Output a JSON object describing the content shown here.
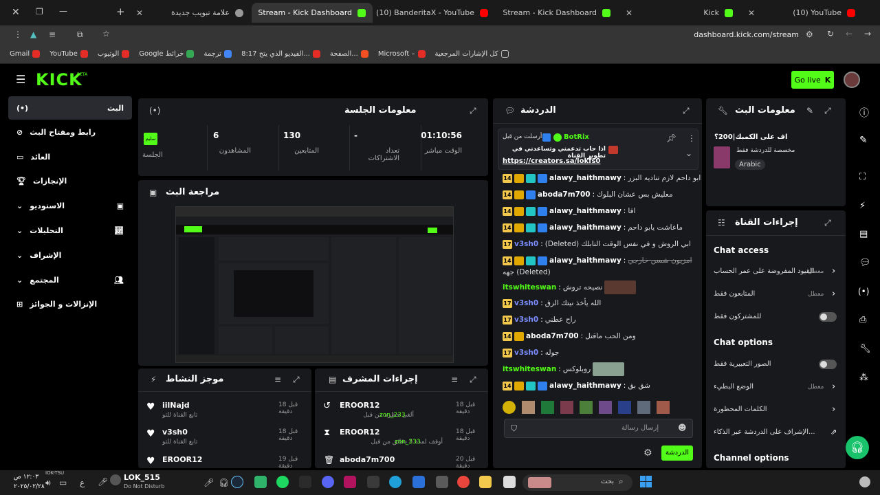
{
  "browser": {
    "tabs": [
      {
        "label": "علامة تبويب جديدة",
        "favicon": "new-tab-icon",
        "active": false
      },
      {
        "label": "Stream - Kick Dashboard",
        "favicon": "kick-icon",
        "active": true
      },
      {
        "label": "(10) BanderitaX - YouTube",
        "favicon": "youtube-icon",
        "active": false
      },
      {
        "label": "Stream - Kick Dashboard",
        "favicon": "kick-icon",
        "active": false
      },
      {
        "label": "Kick",
        "favicon": "kick-icon",
        "active": false
      },
      {
        "label": "(10) YouTube",
        "favicon": "youtube-icon",
        "active": false
      }
    ],
    "url": "dashboard.kick.com/stream",
    "bookmarks": [
      {
        "label": "Gmail"
      },
      {
        "label": "YouTube"
      },
      {
        "label": "الوتيوب"
      },
      {
        "label": "Google خرائط"
      },
      {
        "label": "ترجمة"
      },
      {
        "label": "8:17 الفيديو الذي يتح..."
      },
      {
        "label": "الصفحة..."
      },
      {
        "label": "Microsoft –"
      },
      {
        "label": "كل الإشارات المرجعية"
      }
    ]
  },
  "kick": {
    "logo": "KICK",
    "beta": "BETA",
    "go_live": "Go live"
  },
  "sidebar": {
    "items": [
      {
        "label": "البث",
        "icon": "live-icon"
      },
      {
        "label": "رابط ومفتاح البث",
        "icon": "link-icon"
      },
      {
        "label": "العائد",
        "icon": "revenue-icon"
      },
      {
        "label": "الإنجازات",
        "icon": "trophy-icon"
      },
      {
        "label": "الاستوديو",
        "icon": "studio-icon"
      },
      {
        "label": "التحليلات",
        "icon": "analytics-icon"
      },
      {
        "label": "الإشراف",
        "icon": "moderation-icon"
      },
      {
        "label": "المجتمع",
        "icon": "community-icon"
      },
      {
        "label": "الإنزالات و الجوائز",
        "icon": "drops-icon"
      }
    ]
  },
  "session": {
    "title": "معلومات الجلسة",
    "stats": [
      {
        "value": "01:10:56",
        "label": "الوقت مباشر"
      },
      {
        "value": "-",
        "label": "تعداد الاشتراكات"
      },
      {
        "value": "130",
        "label": "المتابعين"
      },
      {
        "value": "6",
        "label": "المشاهدون"
      },
      {
        "value": "سليم",
        "label": "الجلسة"
      }
    ]
  },
  "preview": {
    "title": "مراجعة البث"
  },
  "activity": {
    "title": "موجز النشاط",
    "items": [
      {
        "user": "iilNajd",
        "desc": "تابع القناة للتو",
        "time": "قبل 18 دقيقة"
      },
      {
        "user": "v3sh0",
        "desc": "تابع القناة للتو",
        "time": "قبل 18 دقيقة"
      },
      {
        "user": "EROOR12",
        "desc": "",
        "time": "قبل 19 دقيقة"
      }
    ]
  },
  "mod_actions": {
    "title": "إجراءات المشرف",
    "items": [
      {
        "user": "EROOR12",
        "desc": "ألغى حظره من قبل",
        "mod": "zon_233",
        "time": "قبل 18 دقيقة"
      },
      {
        "user": "EROOR12",
        "desc": "أوقف لمدة 5 دقائق من قبل",
        "mod": "zon_233",
        "time": "قبل 18 دقيقة"
      },
      {
        "user": "aboda7m700",
        "desc": "",
        "mod": "",
        "time": "قبل 20 دقيقة"
      }
    ]
  },
  "chat": {
    "title": "الدردشة",
    "pinned": {
      "by": "أرسلت من قبل",
      "user": "BotRix",
      "text": "اذا حاب تدعمني وتساعدني في تطوير القناة",
      "link": "https://creators.sa/lokfs0"
    },
    "messages": [
      {
        "user": "alawy_haithmawy",
        "badge": "14",
        "text": "ابو داحم لازم تناديه البزر",
        "color": "#ffffff"
      },
      {
        "user": "aboda7m700",
        "badge": "14",
        "text": "معليش بس عشان البلوك",
        "color": "#ffffff"
      },
      {
        "user": "alawy_haithmawy",
        "badge": "14",
        "text": "افا",
        "color": "#ffffff"
      },
      {
        "user": "alawy_haithmawy",
        "badge": "14",
        "text": "ماعاشت يابو داحم",
        "color": "#ffffff"
      },
      {
        "user": "v3sh0",
        "badge": "17",
        "text": "ابي الروش و في نفس الوقت التابلك (Deleted)",
        "color": "#7b8cff"
      },
      {
        "user": "alawy_haithmawy",
        "badge": "14",
        "text": "امزيون شسن خارجي",
        "color": "#ffffff"
      },
      {
        "user": "",
        "badge": "",
        "text": "(Deleted) جهه",
        "color": "#ffffff"
      },
      {
        "user": "itswhiteswan",
        "badge": "",
        "text": "نصيحه تروش",
        "color": "#53fc18"
      },
      {
        "user": "v3sh0",
        "badge": "17",
        "text": "الله يأخذ نيتك الزق",
        "color": "#7b8cff"
      },
      {
        "user": "v3sh0",
        "badge": "17",
        "text": "راح عطني",
        "color": "#7b8cff"
      },
      {
        "user": "aboda7m700",
        "badge": "14",
        "text": "ومن الحب ماقتل",
        "color": "#ffffff"
      },
      {
        "user": "v3sh0",
        "badge": "17",
        "text": "جوله",
        "color": "#7b8cff"
      },
      {
        "user": "itswhiteswan",
        "badge": "",
        "text": "روبلوكس",
        "color": "#53fc18"
      },
      {
        "user": "alawy_haithmawy",
        "badge": "14",
        "text": "شق بق",
        "color": "#ffffff"
      }
    ],
    "input_placeholder": "إرسال رسالة",
    "send_label": "الدردشة"
  },
  "stream_info": {
    "title": "معلومات البث",
    "stream_title": "اف على الكمبك|200؟",
    "category": "مخصصة للدردشة فقط",
    "language": "Arabic"
  },
  "channel_actions": {
    "title": "إجراءات القناة",
    "chat_access_title": "Chat access",
    "chat_access": [
      {
        "label": "القيود المفروضة على عمر الحساب",
        "state": "معطل",
        "type": "chevron"
      },
      {
        "label": "المتابعون فقط",
        "state": "معطل",
        "type": "chevron"
      },
      {
        "label": "للمشتركون فقط",
        "state": "",
        "type": "toggle"
      }
    ],
    "chat_options_title": "Chat options",
    "chat_options": [
      {
        "label": "الصور التعبيرية فقط",
        "state": "",
        "type": "toggle"
      },
      {
        "label": "الوضع البطيء",
        "state": "معطل",
        "type": "chevron"
      },
      {
        "label": "الكلمات المحظورة",
        "state": "",
        "type": "chevron"
      },
      {
        "label": "...الإشراف على الدردشة عبر الذكاء",
        "state": "",
        "type": "external"
      }
    ],
    "channel_options_title": "Channel options"
  },
  "taskbar": {
    "time": "١٢:٠٣ ص",
    "date": "٢٠٢٥/٠٢/٢٨",
    "user": "LOK_515",
    "status": "Do Not Disturb",
    "ticker": "IOK-TSU",
    "search": "بحث"
  },
  "colors": {
    "accent": "#53fc18",
    "panel": "#18191c",
    "background": "#000000"
  }
}
